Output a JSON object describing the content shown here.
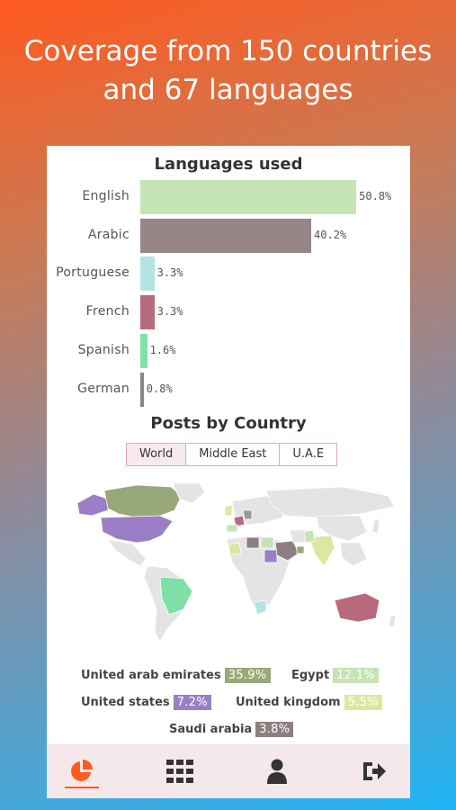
{
  "headline": {
    "line1": "Coverage from 150 countries",
    "line2": "and 67 languages"
  },
  "languages": {
    "title": "Languages used",
    "items": [
      {
        "label": "English",
        "value": 50.8,
        "pct": "50.8%",
        "color": "#c6e5b5"
      },
      {
        "label": "Arabic",
        "value": 40.2,
        "pct": "40.2%",
        "color": "#968688"
      },
      {
        "label": "Portuguese",
        "value": 3.3,
        "pct": "3.3%",
        "color": "#b3e5e0"
      },
      {
        "label": "French",
        "value": 3.3,
        "pct": "3.3%",
        "color": "#b86a7c"
      },
      {
        "label": "Spanish",
        "value": 1.6,
        "pct": "1.6%",
        "color": "#7fe0a8"
      },
      {
        "label": "German",
        "value": 0.8,
        "pct": "0.8%",
        "color": "#888888"
      }
    ]
  },
  "chart_data": {
    "type": "bar",
    "title": "Languages used",
    "categories": [
      "English",
      "Arabic",
      "Portuguese",
      "French",
      "Spanish",
      "German"
    ],
    "values": [
      50.8,
      40.2,
      3.3,
      3.3,
      1.6,
      0.8
    ],
    "xlim": [
      0,
      55
    ]
  },
  "countries": {
    "title": "Posts by Country",
    "tabs": [
      "World",
      "Middle East",
      "U.A.E"
    ],
    "active_tab": "World",
    "legend": [
      {
        "name": "United arab emirates",
        "pct": "35.9%",
        "color": "#98a878"
      },
      {
        "name": "Egypt",
        "pct": "12.1%",
        "color": "#c5e3b3"
      },
      {
        "name": "United states",
        "pct": "7.2%",
        "color": "#9a7fc6"
      },
      {
        "name": "United kingdom",
        "pct": "5.5%",
        "color": "#dbe8a0"
      },
      {
        "name": "Saudi arabia",
        "pct": "3.8%",
        "color": "#8e7e80"
      }
    ]
  },
  "nav": {
    "items": [
      {
        "icon": "pie-chart-icon",
        "active": true
      },
      {
        "icon": "grid-icon",
        "active": false
      },
      {
        "icon": "user-icon",
        "active": false
      },
      {
        "icon": "logout-icon",
        "active": false
      }
    ],
    "accent": "#ff5a1f"
  }
}
